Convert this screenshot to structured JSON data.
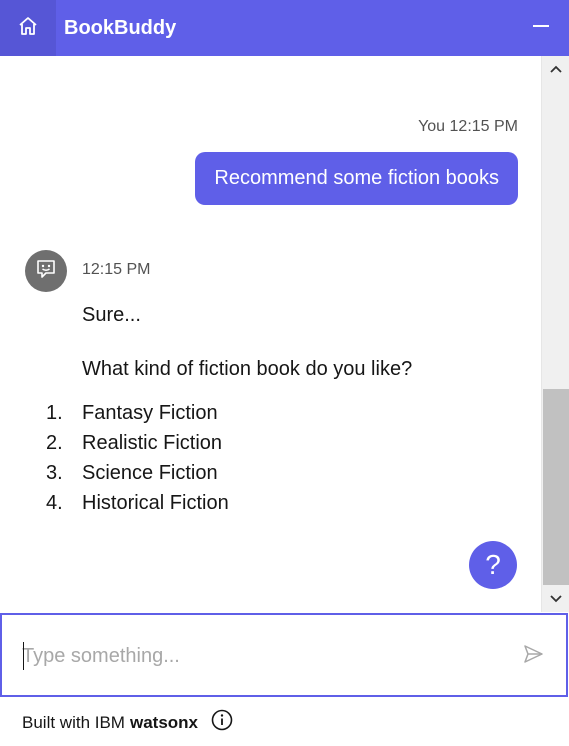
{
  "header": {
    "title": "BookBuddy",
    "home_icon": "home-icon",
    "minimize_icon": "minimize-icon",
    "accent_color": "#5f5fe8"
  },
  "user_message": {
    "sender": "You",
    "time": "12:15 PM",
    "text": "Recommend some fiction books"
  },
  "bot_message": {
    "avatar_icon": "bot-face-icon",
    "time": "12:15 PM",
    "line1": "Sure...",
    "line2": "What kind of fiction book do you like?",
    "options": [
      {
        "num": "1.",
        "label": "Fantasy Fiction"
      },
      {
        "num": "2.",
        "label": "Realistic Fiction"
      },
      {
        "num": "3.",
        "label": "Science Fiction"
      },
      {
        "num": "4.",
        "label": "Historical Fiction"
      }
    ]
  },
  "help_button": {
    "label": "?"
  },
  "input": {
    "placeholder": "Type something...",
    "value": "",
    "send_icon": "send-icon"
  },
  "footer": {
    "prefix": "Built with IBM",
    "brand": "watsonx",
    "info_icon": "info-icon"
  }
}
